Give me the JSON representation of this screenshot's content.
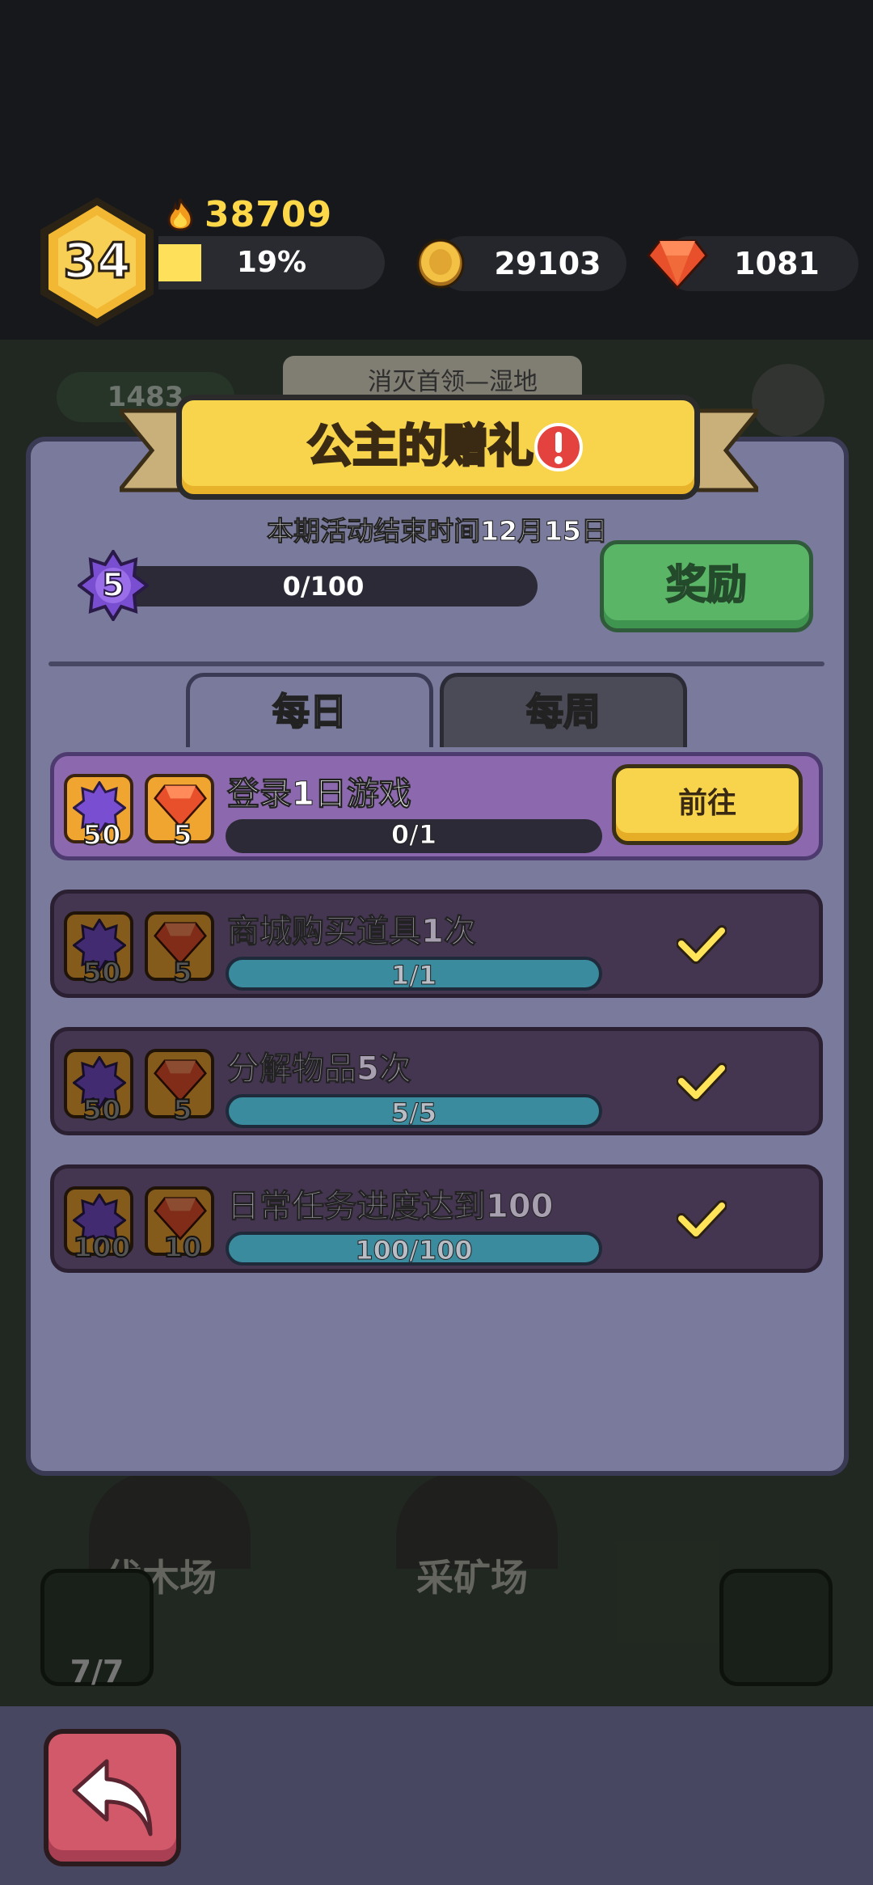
{
  "header": {
    "level": "34",
    "power": "38709",
    "xp_percent_label": "19%",
    "xp_fraction": 0.19,
    "coins": "29103",
    "gems": "1081"
  },
  "background": {
    "meat_count": "1483",
    "search_hint": "消灭首领—湿地",
    "building_left": "伐木场",
    "building_right": "采矿场",
    "team_count": "7/7"
  },
  "dialog": {
    "title": "公主的赠礼",
    "subtitle": "本期活动结束时间12月15日",
    "star_level": "5",
    "progress_text": "0/100",
    "progress_fraction": 0.0,
    "reward_button": "奖励",
    "tabs": [
      {
        "label": "每日",
        "active": true
      },
      {
        "label": "每周",
        "active": false
      }
    ],
    "tasks": [
      {
        "label": "登录1日游戏",
        "star_reward": "50",
        "gem_reward": "5",
        "progress": "0/1",
        "state": "active",
        "action": "前往"
      },
      {
        "label": "商城购买道具1次",
        "star_reward": "50",
        "gem_reward": "5",
        "progress": "1/1",
        "state": "done"
      },
      {
        "label": "分解物品5次",
        "star_reward": "50",
        "gem_reward": "5",
        "progress": "5/5",
        "state": "done"
      },
      {
        "label": "日常任务进度达到100",
        "star_reward": "100",
        "gem_reward": "10",
        "progress": "100/100",
        "state": "done"
      }
    ]
  },
  "colors": {
    "accent_yellow": "#f7d44c",
    "reward_green": "#5ab566",
    "dialog_bg": "#7a7a9c",
    "task_active": "#8c68ae",
    "task_done": "#443551",
    "back_button": "#d2596a"
  },
  "icons": {
    "level": "hexagon-badge-icon",
    "power": "flame-icon",
    "coins": "coin-icon",
    "gems": "gem-icon",
    "star": "purple-star-icon",
    "alert": "exclamation-icon",
    "completed": "checkmark-icon",
    "back": "back-arrow-icon"
  }
}
